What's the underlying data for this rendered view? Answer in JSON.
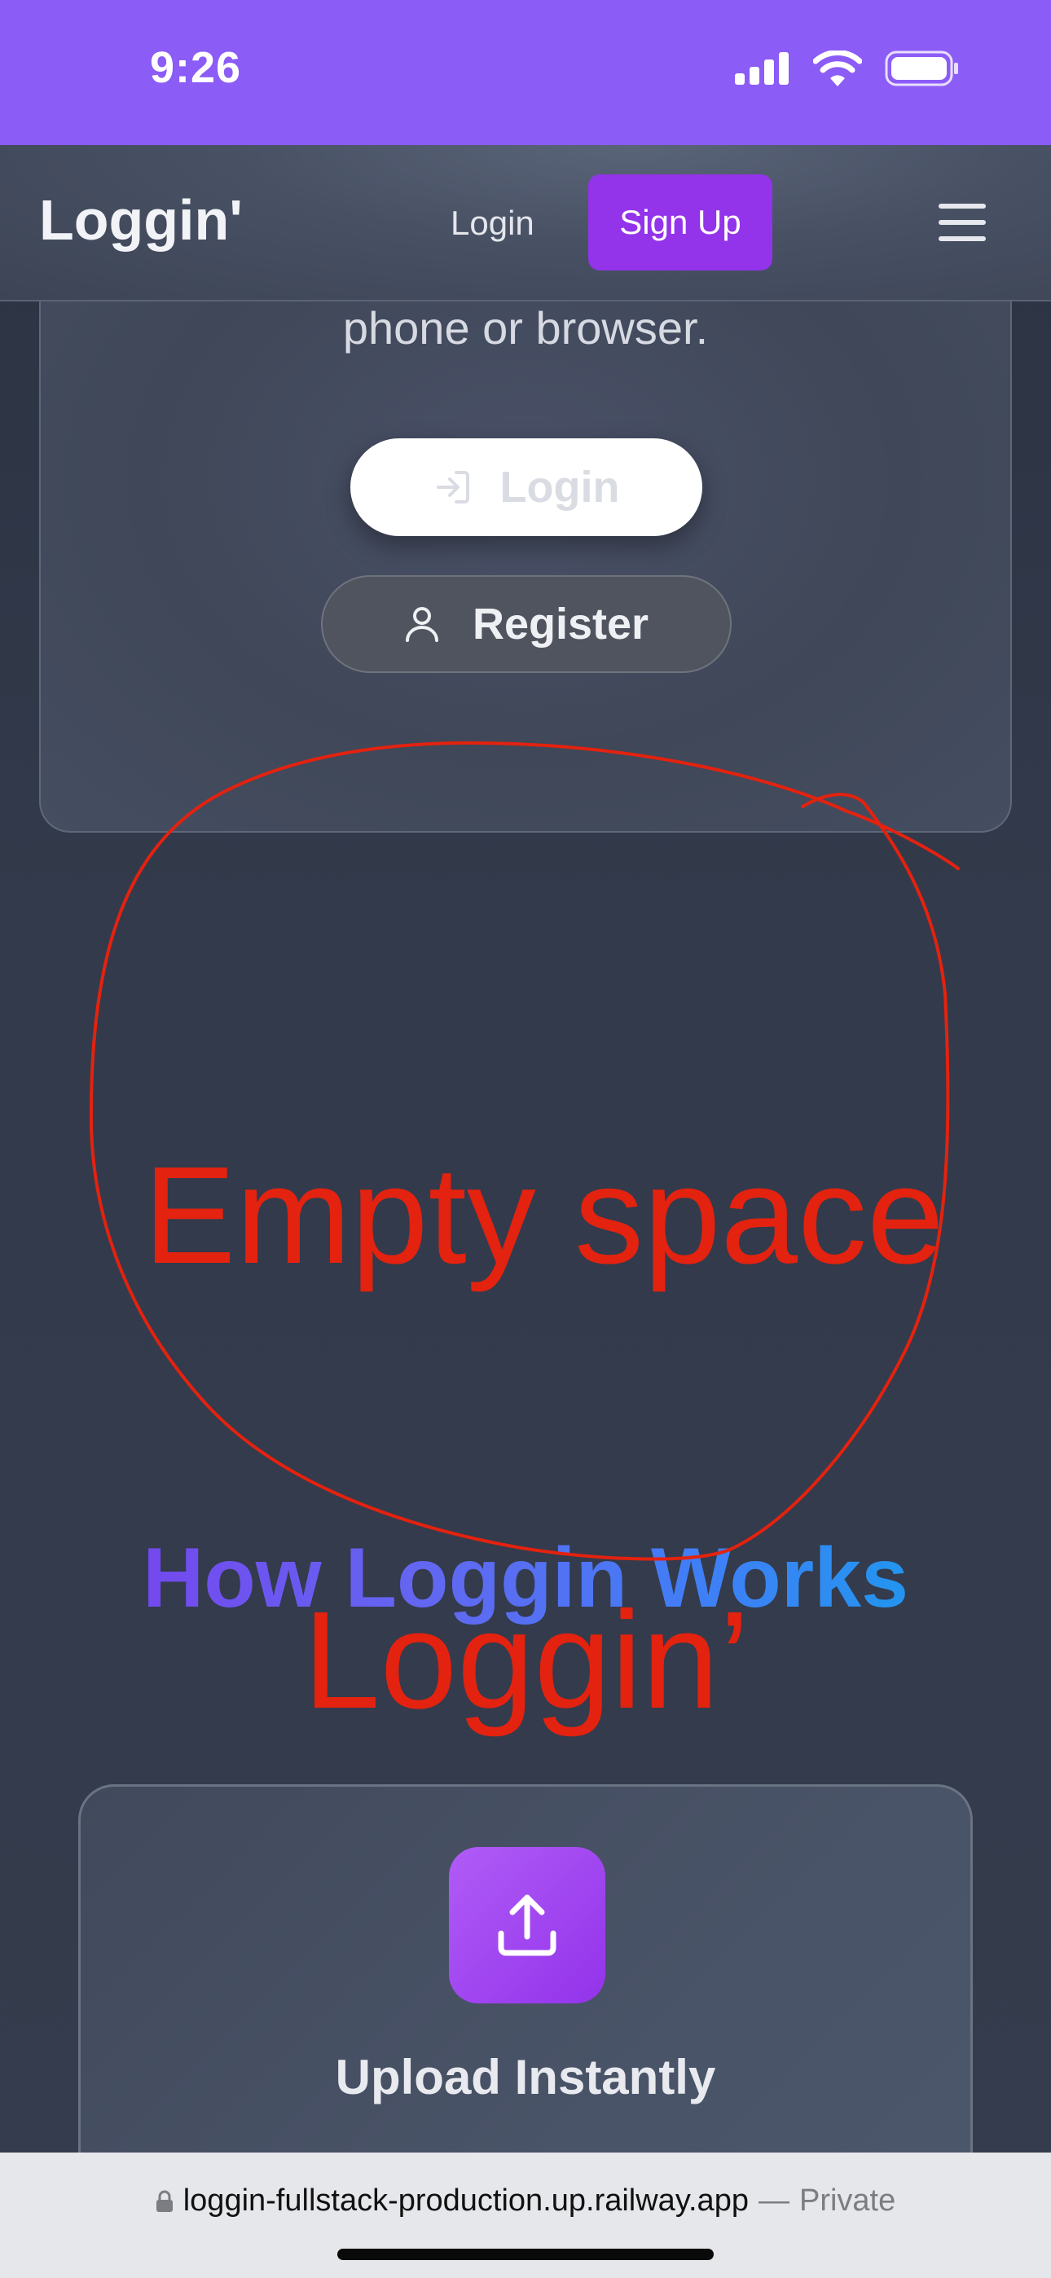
{
  "status_bar": {
    "time": "9:26",
    "accent": "#8b5cf6"
  },
  "navbar": {
    "brand": "Loggin'",
    "login_label": "Login",
    "signup_label": "Sign Up",
    "menu_icon": "hamburger-icon",
    "signup_color": "#9333ea"
  },
  "hero": {
    "text": "phone or browser.",
    "login_button": "Login",
    "register_button": "Register",
    "login_icon": "login-arrow-icon",
    "register_icon": "user-icon"
  },
  "annotation": {
    "empty_label": "Empty space",
    "loggin_label": "Loggin’",
    "color": "#e3220f"
  },
  "section": {
    "title": "How Loggin Works"
  },
  "feature": {
    "title": "Upload Instantly",
    "icon": "upload-icon",
    "icon_color": "#9333ea"
  },
  "browser": {
    "url": "loggin-fullstack-production.up.railway.app",
    "separator": "—",
    "private_label": "Private",
    "lock_icon": "lock-icon"
  }
}
